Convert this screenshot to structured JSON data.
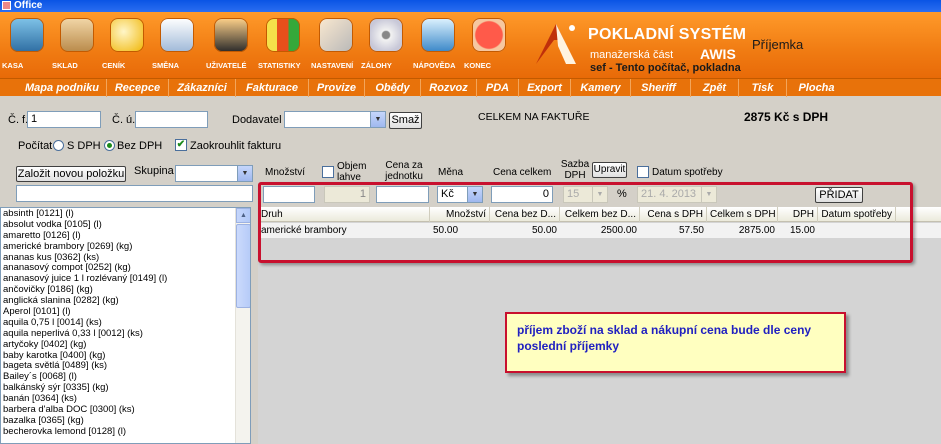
{
  "window": {
    "title": "Office"
  },
  "toolbar": {
    "buttons": [
      {
        "label": "KASA",
        "icon": "cash-register-icon"
      },
      {
        "label": "SKLAD",
        "icon": "boxes-icon"
      },
      {
        "label": "CENÍK",
        "icon": "coins-icon"
      },
      {
        "label": "SMĚNA",
        "icon": "waiter-icon"
      },
      {
        "label": "UŽIVATELÉ",
        "icon": "users-icon"
      },
      {
        "label": "STATISTIKY",
        "icon": "bar-chart-icon"
      },
      {
        "label": "NASTAVENÍ",
        "icon": "tools-icon"
      },
      {
        "label": "ZÁLOHY",
        "icon": "disc-icon"
      },
      {
        "label": "NÁPOVĚDA",
        "icon": "help-icon"
      },
      {
        "label": "KONEC",
        "icon": "close-icon"
      }
    ]
  },
  "brand": {
    "title": "POKLADNÍ SYSTÉM",
    "subtitle": "manažerská část",
    "product": "AWIS",
    "module": "Příjemka",
    "user_line": "sef  -  Tento počítač, pokladna"
  },
  "menu": {
    "items": [
      "Mapa podniku",
      "Recepce",
      "Zákazníci",
      "Fakturace",
      "Provize",
      "Obědy",
      "Rozvoz",
      "PDA",
      "Export",
      "Kamery",
      "Sheriff",
      "Zpět",
      "Tisk",
      "Plocha"
    ]
  },
  "form": {
    "cf_label": "Č. f.",
    "cf_value": "1",
    "cu_label": "Č. ú.",
    "cu_value": "",
    "dodavatel_label": "Dodavatel",
    "dodavatel_value": "",
    "smaz_button": "Smaž",
    "total_label": "CELKEM NA FAKTUŘE",
    "total_value": "2875 Kč s DPH",
    "pocitat_label": "Počítat",
    "radio_s_dph": "S DPH",
    "radio_bez_dph": "Bez DPH",
    "zaokrouhlit_label": "Zaokrouhlit fakturu",
    "new_item_button": "Založit novou položku",
    "skupina_label": "Skupina",
    "skupina_value": "",
    "search_value": ""
  },
  "entry": {
    "mnozstvi_label": "Množství",
    "objem_label": "Objem lahve",
    "cena_za_label": "Cena za jednotku",
    "mena_label": "Měna",
    "cena_celkem_label": "Cena celkem",
    "sazba_label": "Sazba DPH",
    "upravit_button": "Upravit",
    "datum_label": "Datum spotřeby",
    "mnozstvi_value": "",
    "objem_value": "1",
    "cena_za_value": "",
    "mena_value": "Kč",
    "cena_celkem_value": "0",
    "sazba_value": "15",
    "percent_sign": "%",
    "datum_value": "21. 4. 2013",
    "pridat_button": "PŘIDAT"
  },
  "product_list": [
    "absinth [0121] (l)",
    "absolut vodka [0105] (l)",
    "amaretto [0126] (l)",
    "americké brambory [0269] (kg)",
    "ananas kus [0362] (ks)",
    "ananasový compot [0252] (kg)",
    "ananasový juice 1 l rozlévaný [0149] (l)",
    "ančovičky [0186] (kg)",
    "anglická slanina [0282] (kg)",
    "Aperol [0101] (l)",
    "aquila 0,75 l [0014] (ks)",
    "aquila neperlivá 0,33 l [0012] (ks)",
    "artyčoky [0402] (kg)",
    "baby karotka [0400] (kg)",
    "bageta světlá [0489] (ks)",
    "Bailey´s [0068] (l)",
    "balkánský sýr [0335] (kg)",
    "banán [0364] (ks)",
    "barbera d'alba DOC [0300] (ks)",
    "bazalka [0365] (kg)",
    "becherovka lemond [0128] (l)"
  ],
  "table": {
    "columns": [
      "Druh",
      "Množství",
      "Cena bez D...",
      "Celkem bez D...",
      "Cena s DPH",
      "Celkem s DPH",
      "DPH",
      "Datum spotřeby"
    ],
    "rows": [
      [
        "americké brambory",
        "50.00",
        "50.00",
        "2500.00",
        "57.50",
        "2875.00",
        "15.00",
        ""
      ]
    ]
  },
  "annotation": {
    "text": "příjem zboží na sklad a nákupní cena bude dle ceny poslední příjemky"
  },
  "colors": {
    "toolbar_orange": "#f07b12",
    "annotation_border": "#c8102e",
    "annotation_text": "#2020c0"
  }
}
